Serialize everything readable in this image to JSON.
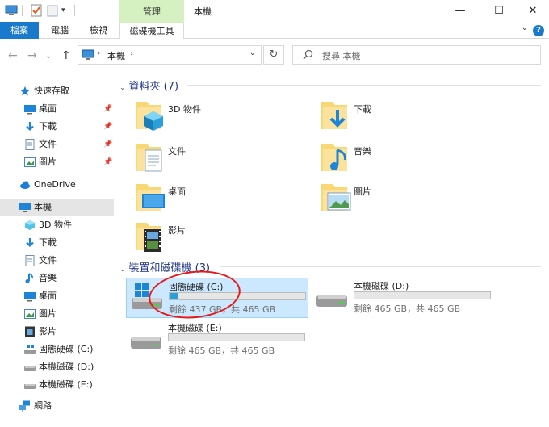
{
  "window": {
    "title": "本機",
    "manage_tab": "管理",
    "controls": [
      "—",
      "☐",
      "✕"
    ]
  },
  "ribbon": {
    "tabs": [
      "檔案",
      "電腦",
      "檢視",
      "磁碟機工具"
    ]
  },
  "address": {
    "back": "←",
    "forward": "→",
    "up": "↑",
    "path": [
      "本機"
    ],
    "search_placeholder": "搜尋 本機"
  },
  "nav": {
    "quick_access": "快速存取",
    "quick_items": [
      {
        "label": "桌面",
        "icon": "desktop-icon"
      },
      {
        "label": "下載",
        "icon": "download-icon"
      },
      {
        "label": "文件",
        "icon": "document-icon"
      },
      {
        "label": "圖片",
        "icon": "picture-icon"
      }
    ],
    "onedrive": "OneDrive",
    "this_pc": "本機",
    "pc_items": [
      {
        "label": "3D 物件",
        "icon": "3d-objects-icon"
      },
      {
        "label": "下載",
        "icon": "download-icon"
      },
      {
        "label": "文件",
        "icon": "document-icon"
      },
      {
        "label": "音樂",
        "icon": "music-icon"
      },
      {
        "label": "桌面",
        "icon": "desktop-icon"
      },
      {
        "label": "圖片",
        "icon": "picture-icon"
      },
      {
        "label": "影片",
        "icon": "video-icon"
      },
      {
        "label": "固態硬碟 (C:)",
        "icon": "windows-drive-icon"
      },
      {
        "label": "本機磁碟 (D:)",
        "icon": "drive-icon"
      },
      {
        "label": "本機磁碟 (E:)",
        "icon": "drive-icon"
      }
    ],
    "network": "網路"
  },
  "folders": {
    "header": "資料夾 (7)",
    "items": [
      {
        "name": "3D 物件",
        "icon": "3d-objects-folder-icon"
      },
      {
        "name": "下載",
        "icon": "downloads-folder-icon"
      },
      {
        "name": "文件",
        "icon": "documents-folder-icon"
      },
      {
        "name": "音樂",
        "icon": "music-folder-icon"
      },
      {
        "name": "桌面",
        "icon": "desktop-folder-icon"
      },
      {
        "name": "圖片",
        "icon": "pictures-folder-icon"
      },
      {
        "name": "影片",
        "icon": "videos-folder-icon"
      }
    ]
  },
  "drives": {
    "header": "裝置和磁碟機 (3)",
    "items": [
      {
        "name": "固態硬碟 (C:)",
        "info": "剩餘 437 GB，共 465 GB",
        "used_fraction": 0.06,
        "selected": true
      },
      {
        "name": "本機磁碟 (D:)",
        "info": "剩餘 465 GB，共 465 GB",
        "used_fraction": 0.0
      },
      {
        "name": "本機磁碟 (E:)",
        "info": "剩餘 465 GB，共 465 GB",
        "used_fraction": 0.0
      }
    ]
  },
  "colors": {
    "accent": "#1979ca",
    "manage_tab_bg": "#d5f0c1",
    "selection_bg": "#cce8ff",
    "bar_fill": "#26a0da",
    "annotation": "#e41b1b",
    "group_header": "#1e3287"
  }
}
